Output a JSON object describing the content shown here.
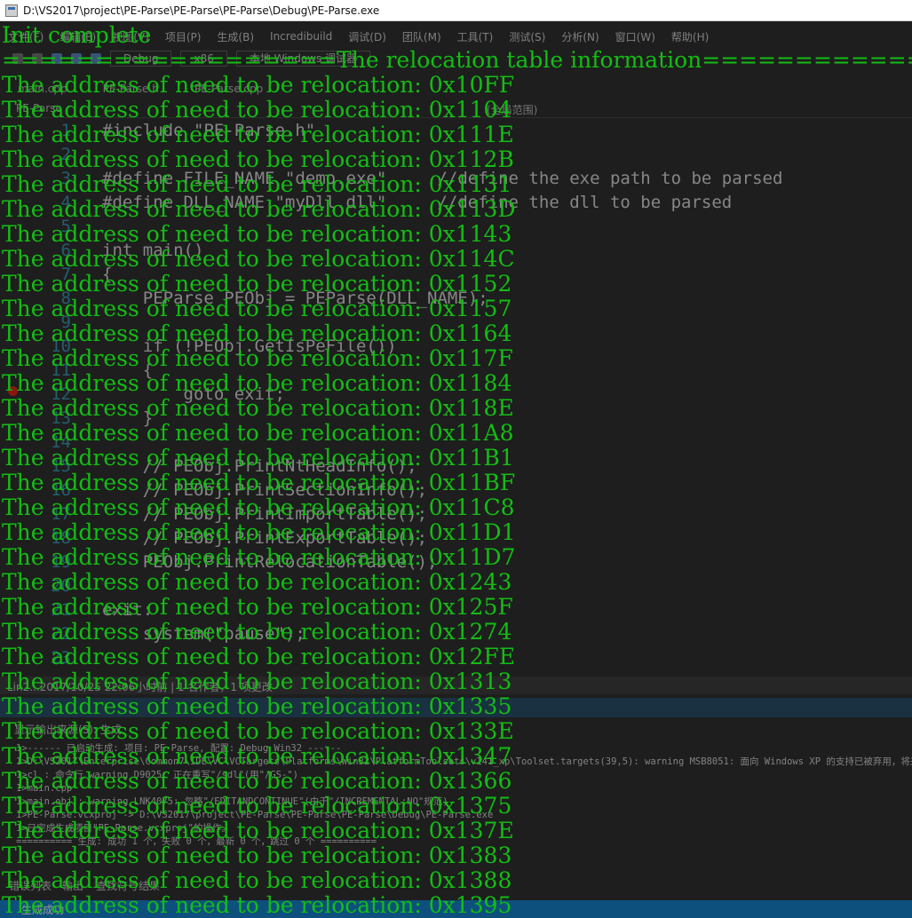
{
  "window": {
    "title": "D:\\VS2017\\project\\PE-Parse\\PE-Parse\\PE-Parse\\Debug\\PE-Parse.exe"
  },
  "ide": {
    "menu": [
      "文件(F)",
      "编辑(E)",
      "视图(V)",
      "项目(P)",
      "生成(B)",
      "Incredibuild",
      "调试(D)",
      "团队(M)",
      "工具(T)",
      "测试(S)",
      "分析(N)",
      "窗口(W)",
      "帮助(H)"
    ],
    "toolbar": {
      "config": "Debug",
      "platform": "x86",
      "run_label": "本地 Windows 调试器"
    },
    "tabs": [
      "main.cpp",
      "PE-Parse.h",
      "PE-Parse.cpp"
    ],
    "navbar": {
      "project": "PE-Parse",
      "scope": "(全局范围)"
    },
    "code_lines": [
      {
        "n": "1",
        "text": "#include \"PE-Parse.h\""
      },
      {
        "n": "2",
        "text": ""
      },
      {
        "n": "3",
        "text": "#define FILE_NAME \"demo.exe\"     //define the exe path to be parsed"
      },
      {
        "n": "4",
        "text": "#define DLL_NAME \"myDll.dll\"     //define the dll to be parsed"
      },
      {
        "n": "5",
        "text": ""
      },
      {
        "n": "6",
        "text": "int main()"
      },
      {
        "n": "7",
        "text": "{"
      },
      {
        "n": "8",
        "text": "    PEParse PEObj = PEParse(DLL_NAME);"
      },
      {
        "n": "9",
        "text": ""
      },
      {
        "n": "10",
        "text": "    if (!PEObj.GetIsPeFile())"
      },
      {
        "n": "11",
        "text": "    {"
      },
      {
        "n": "12",
        "text": "        goto exit;"
      },
      {
        "n": "13",
        "text": "    }"
      },
      {
        "n": "14",
        "text": ""
      },
      {
        "n": "15",
        "text": "    // PEObj.PrintNtHeadInfo();"
      },
      {
        "n": "16",
        "text": "    // PEObj.PrintSectionInfo();"
      },
      {
        "n": "17",
        "text": "    // PEObj.PrintImportTable();"
      },
      {
        "n": "18",
        "text": "    // PEObj.PrintExportTable();"
      },
      {
        "n": "19",
        "text": "    PEObj.PrintRelocationTable();"
      },
      {
        "n": "20",
        "text": ""
      },
      {
        "n": "21",
        "text": "exit:"
      },
      {
        "n": "22",
        "text": "    system(\"pause\");"
      },
      {
        "n": "23",
        "text": ""
      }
    ],
    "status": "Lin2...2017/10/25 22:06小时前 | 1 名作者，1 项更改",
    "output_header": "显示输出来源(S): 生成",
    "output_lines": [
      "1>------ 已启动生成: 项目: PE-Parse, 配置: Debug Win32 ------",
      "1>D:\\VS2017\\Enterprise\\Common7\\IDE\\VC\\VCTargets\\Platforms\\Win32\\PlatformToolsets\\v141_xp\\Toolset.targets(39,5): warning MSB8051: 面向 Windows XP 的支持已被弃用，将来的",
      "1>cl : 命令行 warning D9025: 正在重写\"/sdl\"(用\"/GS-\")",
      "1>main.cpp",
      "1>main.obj : warning LNK4075: 忽略\"/EDITANDCONTINUE\"(由于\"/INCREMENTAL:NO\"规范)",
      "1>PE-Parse.vcxproj -> D:\\VS2017\\project\\PE-Parse\\PE-Parse\\PE-Parse\\Debug\\PE-Parse.exe",
      "1>已完成生成项目\"PE-Parse.vcxproj\"的操作。",
      "========== 生成: 成功 1 个，失败 0 个，最新 0 个，跳过 0 个 =========="
    ],
    "bottom_tabs": [
      "错误列表",
      "输出",
      "查找符号结果"
    ],
    "bottom_status": "生成成功"
  },
  "console": {
    "lines": [
      "Init complete",
      "==================The relocation table information==================",
      "The address of need to be relocation: 0x10FF",
      "The address of need to be relocation: 0x1104",
      "The address of need to be relocation: 0x111E",
      "The address of need to be relocation: 0x112B",
      "The address of need to be relocation: 0x1131",
      "The address of need to be relocation: 0x113D",
      "The address of need to be relocation: 0x1143",
      "The address of need to be relocation: 0x114C",
      "The address of need to be relocation: 0x1152",
      "The address of need to be relocation: 0x1157",
      "The address of need to be relocation: 0x1164",
      "The address of need to be relocation: 0x117F",
      "The address of need to be relocation: 0x1184",
      "The address of need to be relocation: 0x118E",
      "The address of need to be relocation: 0x11A8",
      "The address of need to be relocation: 0x11B1",
      "The address of need to be relocation: 0x11BF",
      "The address of need to be relocation: 0x11C8",
      "The address of need to be relocation: 0x11D1",
      "The address of need to be relocation: 0x11D7",
      "The address of need to be relocation: 0x1243",
      "The address of need to be relocation: 0x125F",
      "The address of need to be relocation: 0x1274",
      "The address of need to be relocation: 0x12FE",
      "The address of need to be relocation: 0x1313",
      "The address of need to be relocation: 0x1335",
      "The address of need to be relocation: 0x133E",
      "The address of need to be relocation: 0x1347",
      "The address of need to be relocation: 0x1366",
      "The address of need to be relocation: 0x1375",
      "The address of need to be relocation: 0x137E",
      "The address of need to be relocation: 0x1383",
      "The address of need to be relocation: 0x1388",
      "The address of need to be relocation: 0x1395"
    ]
  },
  "colors": {
    "console_text": "#13bd13",
    "console_bg": "#1e1e1e",
    "titlebar_bg": "#ffffff",
    "highlight_band": "#16425f",
    "ide_status_blue": "#007acc"
  }
}
